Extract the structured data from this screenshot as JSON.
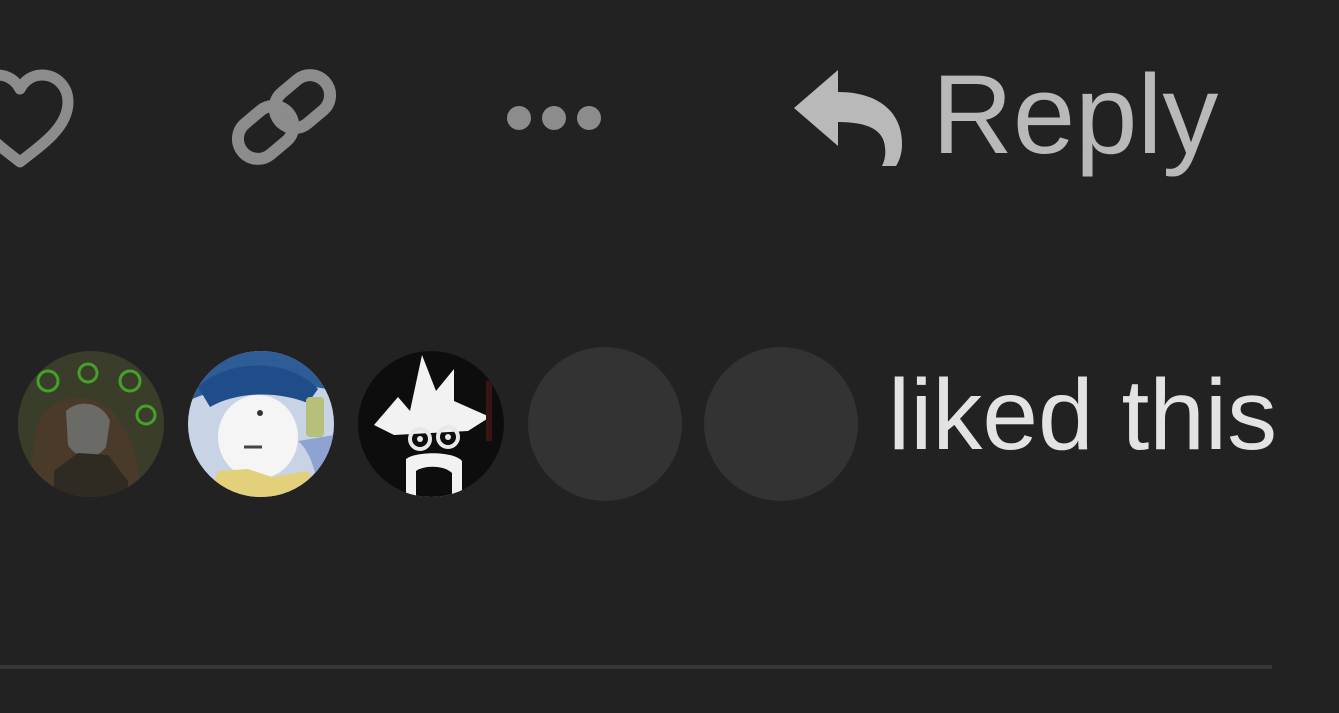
{
  "post_actions": {
    "like_icon": "heart-outline-icon",
    "copy_link_icon": "link-icon",
    "more_icon": "ellipsis-icon",
    "reply": {
      "icon": "reply-arrow-icon",
      "label": "Reply"
    },
    "colors": {
      "background": "#222222",
      "icon": "#8c8c8c",
      "reply": "#b9b9b9",
      "text": "#e3e3e3"
    }
  },
  "likes": {
    "avatars": [
      "green-hooded-figure",
      "blue-cap-character",
      "white-spiky-hair-character",
      "placeholder",
      "placeholder"
    ],
    "text": "liked this"
  }
}
